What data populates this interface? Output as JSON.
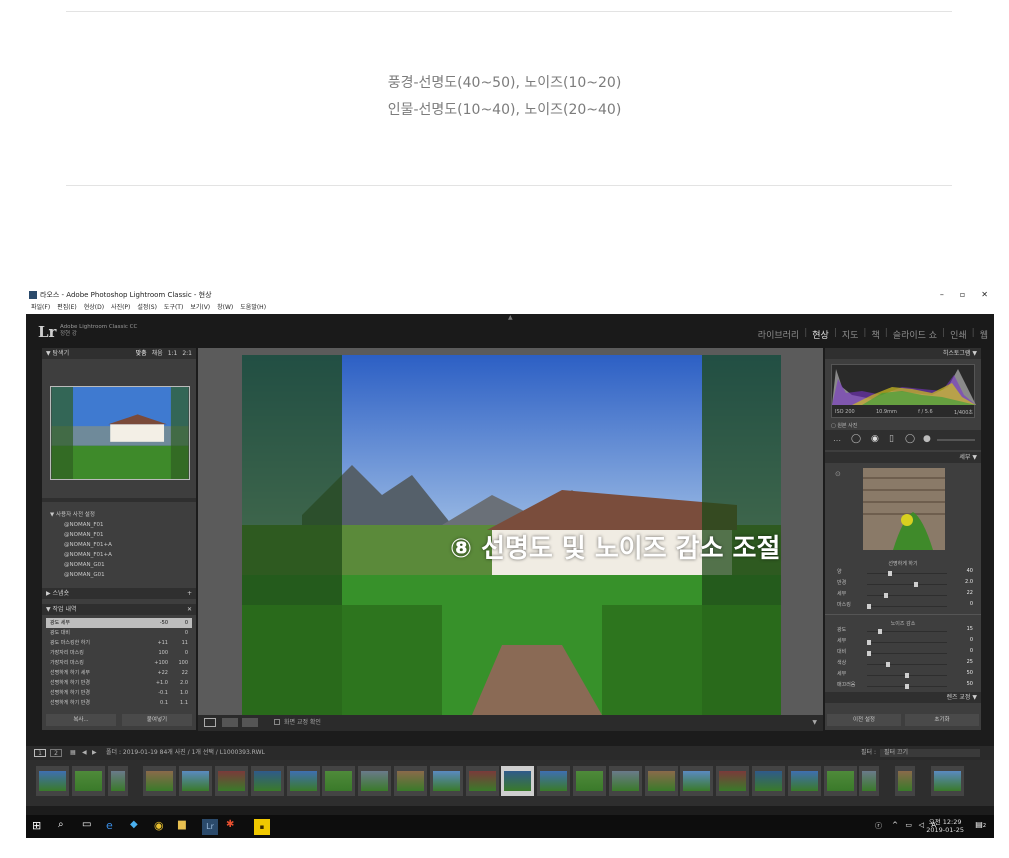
{
  "article": {
    "line1": "풍경-선명도(40~50), 노이즈(10~20)",
    "line2": "인물-선명도(10~40), 노이즈(20~40)"
  },
  "window": {
    "title": "라오스 - Adobe Photoshop Lightroom Classic - 현상",
    "controls": [
      "–",
      "▫",
      "✕"
    ],
    "menu": [
      "파일(F)",
      "편집(E)",
      "현상(D)",
      "사진(P)",
      "설정(S)",
      "도구(T)",
      "보기(V)",
      "창(W)",
      "도움말(H)"
    ]
  },
  "identity": {
    "logo": "Lr",
    "app_name": "Adobe Lightroom Classic CC",
    "user": "정현 강"
  },
  "modules": {
    "items": [
      "라이브러리",
      "현상",
      "지도",
      "책",
      "슬라이드 쇼",
      "인쇄",
      "웹"
    ],
    "active": "현상"
  },
  "navigator": {
    "title": "탐색기",
    "zoom_options": [
      "맞춤",
      "채움",
      "1:1",
      "2:1"
    ]
  },
  "presets": {
    "group_title": "사용자 사전 설정",
    "items": [
      "@NOMAN_F01",
      "@NOMAN_F01",
      "@NOMAN_F01+A",
      "@NOMAN_F01+A",
      "@NOMAN_G01",
      "@NOMAN_G01"
    ]
  },
  "snapshots": {
    "title": "스냅숏"
  },
  "history": {
    "title": "작업 내역",
    "rows": [
      {
        "label": "광도 세부",
        "a": "-50",
        "b": "0"
      },
      {
        "label": "광도 대비",
        "a": "",
        "b": "0"
      },
      {
        "label": "광도 마스킹한 하기",
        "a": "+11",
        "b": "11"
      },
      {
        "label": "가장자리 마스킹",
        "a": "100",
        "b": "0"
      },
      {
        "label": "가장자리 마스킹",
        "a": "+100",
        "b": "100"
      },
      {
        "label": "선명하게 하기 세부",
        "a": "+22",
        "b": "22"
      },
      {
        "label": "선명하게 하기 반경",
        "a": "+1.0",
        "b": "2.0"
      },
      {
        "label": "선명하게 하기 반경",
        "a": "-0.1",
        "b": "1.0"
      },
      {
        "label": "선명하게 하기 반경",
        "a": "0.1",
        "b": "1.1"
      }
    ],
    "copy_button": "복사...",
    "paste_button": "붙여넣기"
  },
  "histogram": {
    "title": "히스토그램",
    "iso": "ISO 200",
    "focal": "10.9mm",
    "aperture": "f / 5.6",
    "shutter": "1/400초",
    "original_photo": "원본 사진"
  },
  "detail": {
    "title": "세부",
    "sharpening": {
      "title": "선명하게 하기",
      "rows": [
        {
          "label": "양",
          "value": "40",
          "pct": 0.27
        },
        {
          "label": "반경",
          "value": "2.0",
          "pct": 0.62
        },
        {
          "label": "세부",
          "value": "22",
          "pct": 0.22
        },
        {
          "label": "마스킹",
          "value": "0",
          "pct": 0.0
        }
      ]
    },
    "noise": {
      "title": "노이즈 감소",
      "rows": [
        {
          "label": "광도",
          "value": "15",
          "pct": 0.15
        },
        {
          "label": "세부",
          "value": "0",
          "pct": 0.0
        },
        {
          "label": "대비",
          "value": "0",
          "pct": 0.0
        },
        {
          "label": "색상",
          "value": "25",
          "pct": 0.25
        },
        {
          "label": "세부",
          "value": "50",
          "pct": 0.5
        },
        {
          "label": "매끄러움",
          "value": "50",
          "pct": 0.5
        }
      ]
    },
    "lens_title": "렌즈 교정",
    "prev_button": "이전 설정",
    "reset_button": "초기화"
  },
  "toolbar": {
    "soft_proof_label": "화면 교정 확인"
  },
  "overlay": {
    "text": "⑧ 선명도 및 노이즈 감소 조절"
  },
  "filmstrip": {
    "pages": [
      "1",
      "2"
    ],
    "path": "폴더 : 2019-01-19  84개 사진 / 1개 선택 / L1000393.RWL",
    "filter_label": "필터 :",
    "filter_value": "필터 끄기",
    "thumb_count": 26,
    "selected_index": 13
  },
  "taskbar": {
    "time": "오전 12:29",
    "date": "2019-01-25",
    "ime": "A",
    "notifications": "2"
  },
  "colors": {
    "accent_text": "#7c7c7c",
    "panel_bg": "#3e3e3e",
    "center_bg": "#5b5b5b"
  }
}
